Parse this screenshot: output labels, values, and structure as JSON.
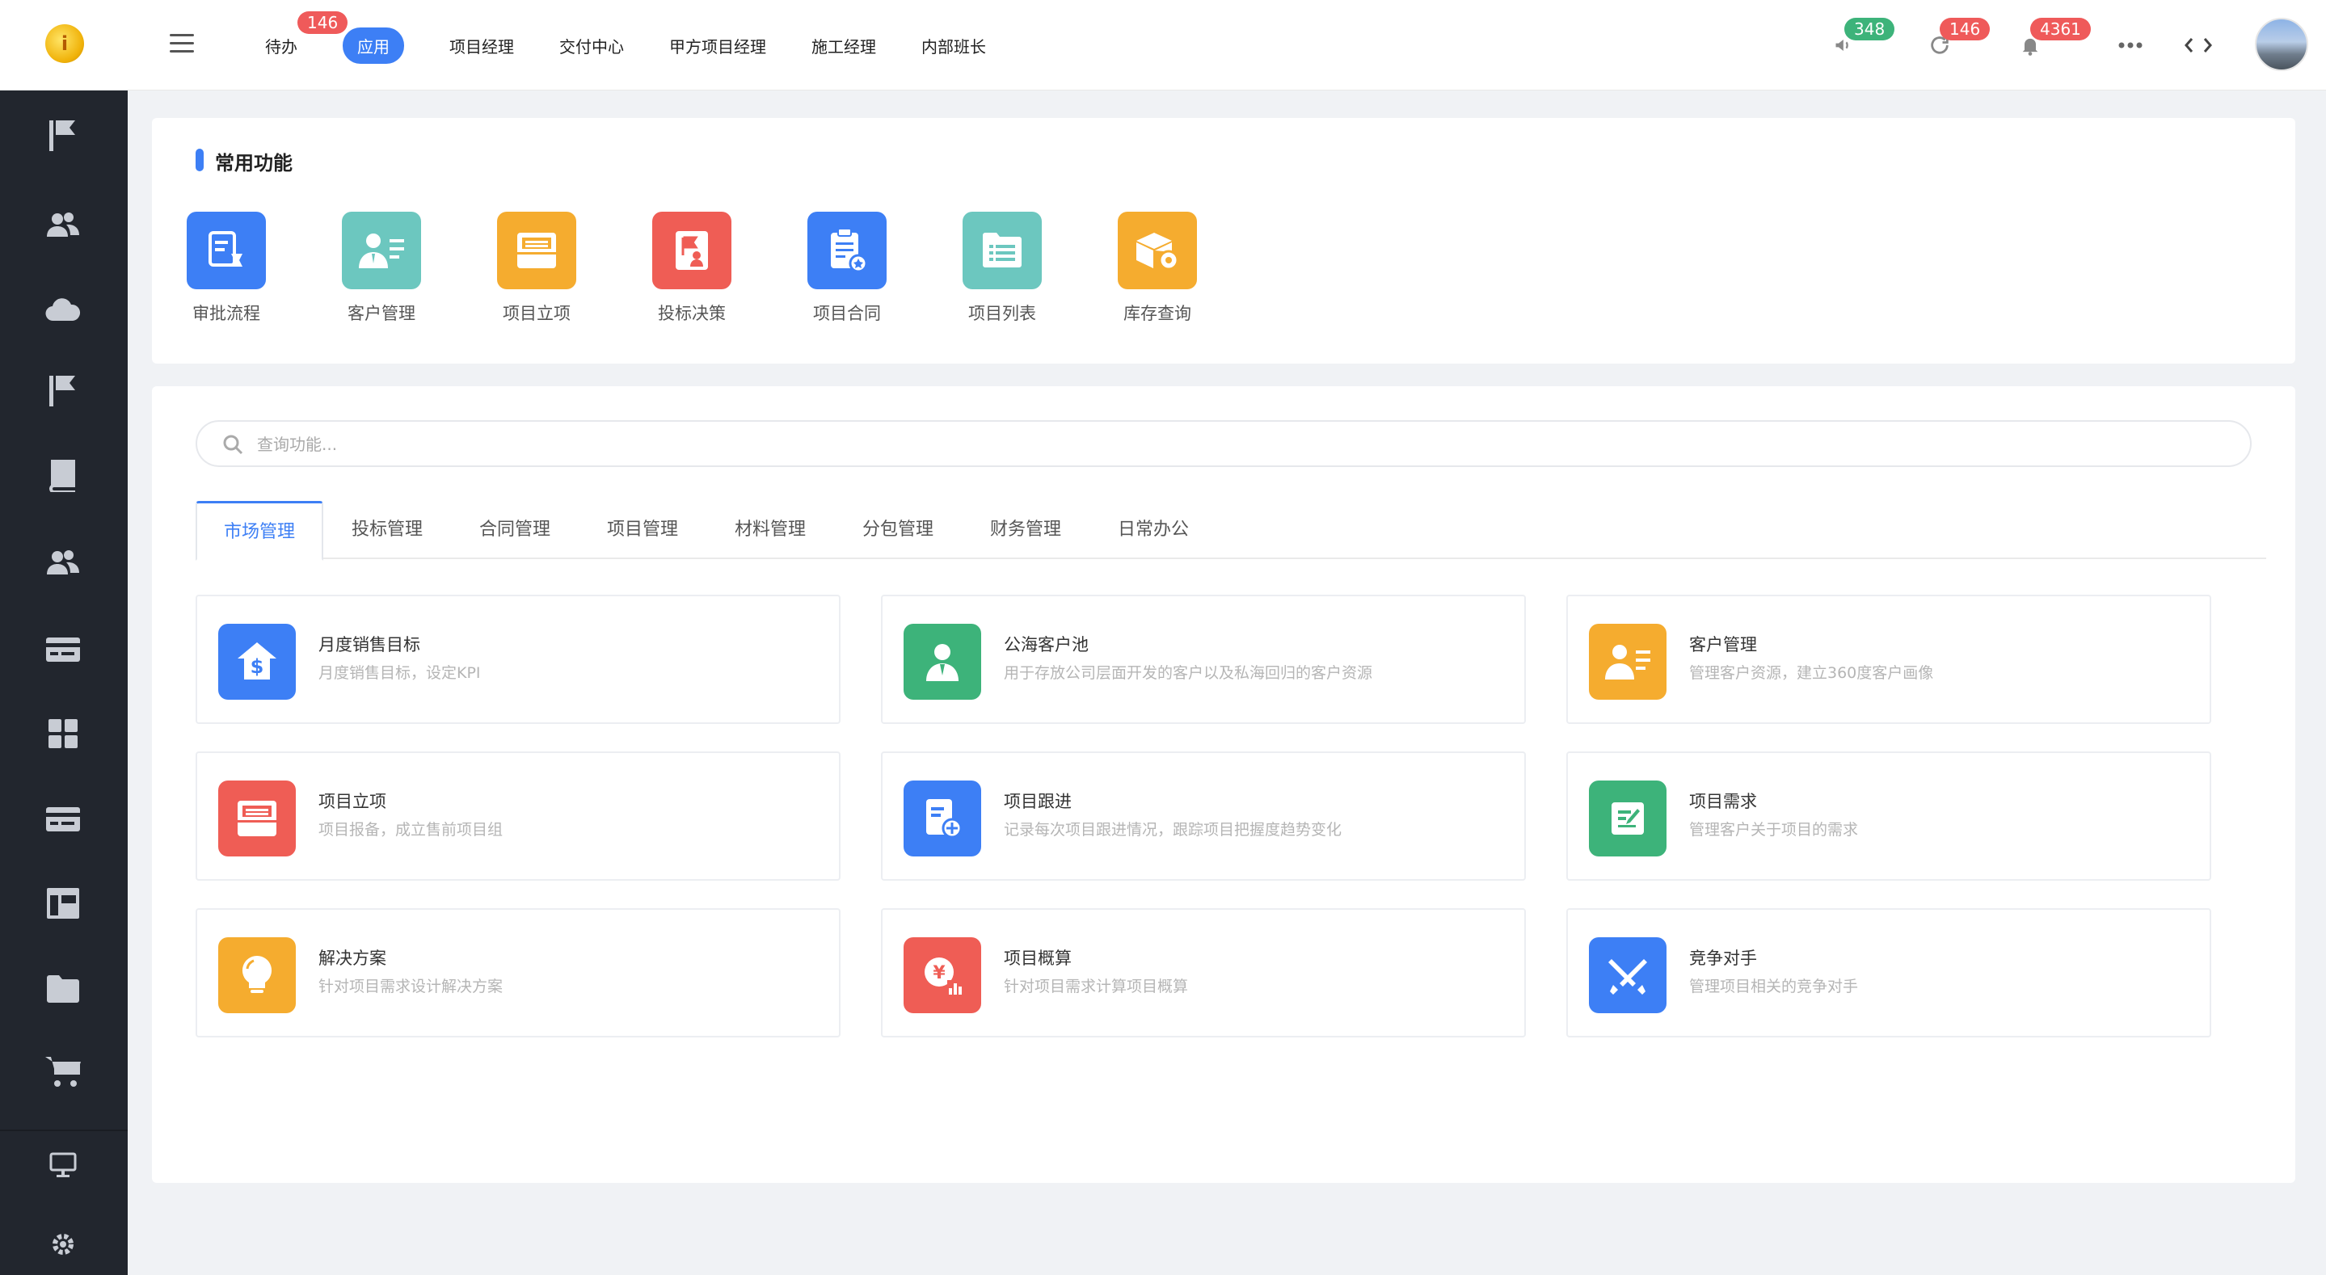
{
  "header": {
    "nav": [
      {
        "label": "待办",
        "badge": "146"
      },
      {
        "label": "应用",
        "active": true
      },
      {
        "label": "项目经理"
      },
      {
        "label": "交付中心"
      },
      {
        "label": "甲方项目经理"
      },
      {
        "label": "施工经理"
      },
      {
        "label": "内部班长"
      }
    ],
    "tools": {
      "announce_badge": "348",
      "sync_badge": "146",
      "notify_badge": "4361"
    }
  },
  "sidebar": {
    "icons": [
      "flag-icon",
      "users-icon",
      "cloud-icon",
      "flag-icon",
      "book-icon",
      "users-icon",
      "card-icon",
      "grid-icon",
      "card-icon",
      "layout-icon",
      "folder-icon",
      "cart-icon",
      "monitor-icon",
      "settings-icon"
    ]
  },
  "common": {
    "title": "常用功能",
    "items": [
      {
        "label": "审批流程",
        "color": "#3d7ff5"
      },
      {
        "label": "客户管理",
        "color": "#6cc7bf"
      },
      {
        "label": "项目立项",
        "color": "#f5ac2f"
      },
      {
        "label": "投标决策",
        "color": "#ef5d55"
      },
      {
        "label": "项目合同",
        "color": "#3d7ff5"
      },
      {
        "label": "项目列表",
        "color": "#6cc7bf"
      },
      {
        "label": "库存查询",
        "color": "#f5ac2f"
      }
    ]
  },
  "search": {
    "placeholder": "查询功能..."
  },
  "tabs": [
    "市场管理",
    "投标管理",
    "合同管理",
    "项目管理",
    "材料管理",
    "分包管理",
    "财务管理",
    "日常办公"
  ],
  "functions": [
    {
      "title": "月度销售目标",
      "desc": "月度销售目标，设定KPI",
      "color": "#3d7ff5",
      "icon": "dollar-house-icon"
    },
    {
      "title": "公海客户池",
      "desc": "用于存放公司层面开发的客户以及私海回归的客户资源",
      "color": "#3db37a",
      "icon": "person-icon"
    },
    {
      "title": "客户管理",
      "desc": "管理客户资源，建立360度客户画像",
      "color": "#f5ac2f",
      "icon": "person-card-icon"
    },
    {
      "title": "项目立项",
      "desc": "项目报备，成立售前项目组",
      "color": "#ef5d55",
      "icon": "box-icon"
    },
    {
      "title": "项目跟进",
      "desc": "记录每次项目跟进情况，跟踪项目把握度趋势变化",
      "color": "#3d7ff5",
      "icon": "doc-plus-icon"
    },
    {
      "title": "项目需求",
      "desc": "管理客户关于项目的需求",
      "color": "#3db37a",
      "icon": "edit-icon"
    },
    {
      "title": "解决方案",
      "desc": "针对项目需求设计解决方案",
      "color": "#f5ac2f",
      "icon": "bulb-icon"
    },
    {
      "title": "项目概算",
      "desc": "针对项目需求计算项目概算",
      "color": "#ef5d55",
      "icon": "yen-chart-icon"
    },
    {
      "title": "竞争对手",
      "desc": "管理项目相关的竞争对手",
      "color": "#3d7ff5",
      "icon": "swords-icon"
    }
  ]
}
